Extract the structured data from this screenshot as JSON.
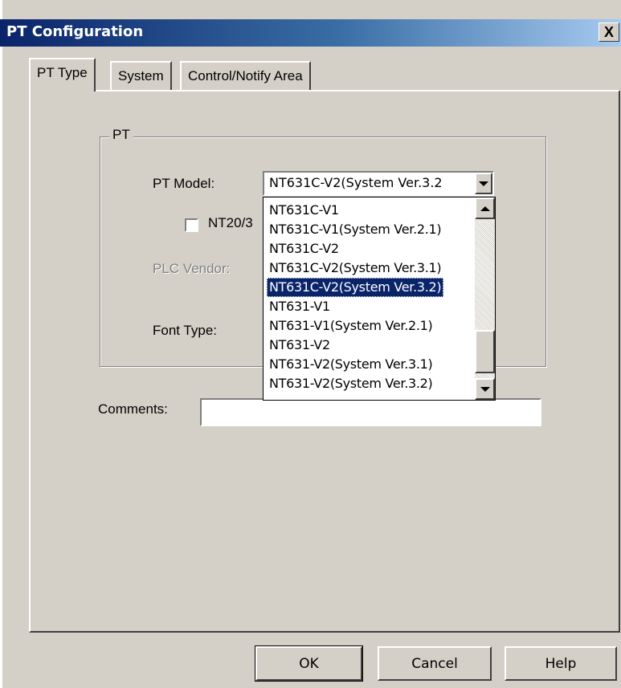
{
  "window": {
    "title": "PT Configuration",
    "close_label": "X"
  },
  "tabs": [
    {
      "label": "PT Type",
      "active": true
    },
    {
      "label": "System",
      "active": false
    },
    {
      "label": "Control/Notify Area",
      "active": false
    }
  ],
  "pt_group": {
    "title": "PT",
    "pt_model_label": "PT Model:",
    "pt_model_value": "NT631C-V2(System Ver.3.2",
    "checkbox_label": "NT20/3",
    "checkbox_checked": false,
    "plc_vendor_label": "PLC Vendor:",
    "font_type_label": "Font Type:"
  },
  "dropdown": {
    "items": [
      "NT631C-V1",
      "NT631C-V1(System Ver.2.1)",
      "NT631C-V2",
      "NT631C-V2(System Ver.3.1)",
      "NT631C-V2(System Ver.3.2)",
      "NT631-V1",
      "NT631-V1(System Ver.2.1)",
      "NT631-V2",
      "NT631-V2(System Ver.3.1)",
      "NT631-V2(System Ver.3.2)"
    ],
    "selected_index": 4
  },
  "comments": {
    "label": "Comments:",
    "value": ""
  },
  "buttons": {
    "ok": "OK",
    "cancel": "Cancel",
    "help": "Help"
  },
  "colors": {
    "titlebar_start": "#0a246a",
    "titlebar_end": "#a6caf0",
    "face": "#d4d0c8",
    "selection": "#0a246a"
  }
}
